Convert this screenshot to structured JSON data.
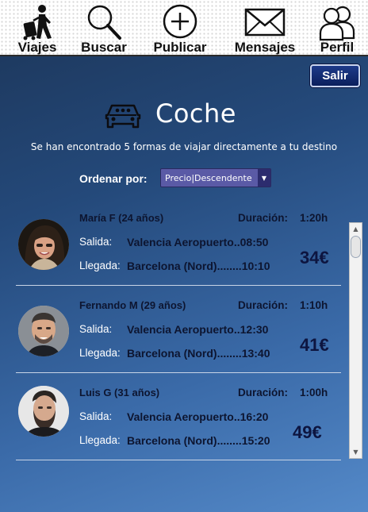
{
  "nav": {
    "items": [
      {
        "label": "Viajes",
        "icon": "traveler-luggage-icon"
      },
      {
        "label": "Buscar",
        "icon": "search-icon"
      },
      {
        "label": "Publicar",
        "icon": "plus-circle-icon"
      },
      {
        "label": "Mensajes",
        "icon": "envelope-icon"
      },
      {
        "label": "Perfil",
        "icon": "users-icon"
      }
    ]
  },
  "logout_label": "Salir",
  "header": {
    "title": "Coche",
    "icon": "car-icon",
    "subtitle": "Se han encontrado 5 formas de viajar directamente a tu destino"
  },
  "sort": {
    "label": "Ordenar por:",
    "selected": "Precio|Descendente"
  },
  "labels": {
    "duration": "Duración:",
    "departure": "Salida:",
    "arrival": "Llegada:"
  },
  "trips": [
    {
      "driver": "María F (24 años)",
      "duration": "1:20h",
      "departure": "Valencia Aeropuerto..08:50",
      "arrival": "Barcelona (Nord)........10:10",
      "price": "34€"
    },
    {
      "driver": "Fernando M (29 años)",
      "duration": "1:10h",
      "departure": "Valencia Aeropuerto..12:30",
      "arrival": "Barcelona (Nord)........13:40",
      "price": "41€"
    },
    {
      "driver": "Luis G (31 años)",
      "duration": "1:00h",
      "departure": "Valencia Aeropuerto..16:20",
      "arrival": "Barcelona (Nord)........15:20",
      "price": "49€"
    }
  ]
}
